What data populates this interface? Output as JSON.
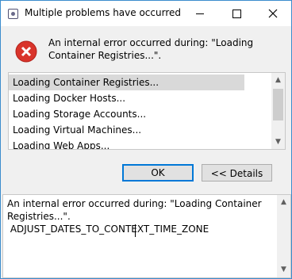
{
  "window": {
    "title": "Multiple problems have occurred"
  },
  "error": {
    "message": "An internal error occurred during: \"Loading Container Registries...\"."
  },
  "problems": [
    "Loading Container Registries...",
    "Loading Docker Hosts...",
    "Loading Storage Accounts...",
    "Loading Virtual Machines...",
    "Loading Web Apps..."
  ],
  "selected_problem_index": 0,
  "buttons": {
    "ok": "OK",
    "details": "<< Details"
  },
  "details": {
    "line1": "An internal error occurred during: \"Loading Container",
    "line2": "Registries...\".",
    "line3": " ADJUST_DATES_TO_CONTEXT_TIME_ZONE"
  },
  "colors": {
    "accent": "#0078d7",
    "error_red": "#d9342b",
    "selection": "#d9d9d9"
  }
}
